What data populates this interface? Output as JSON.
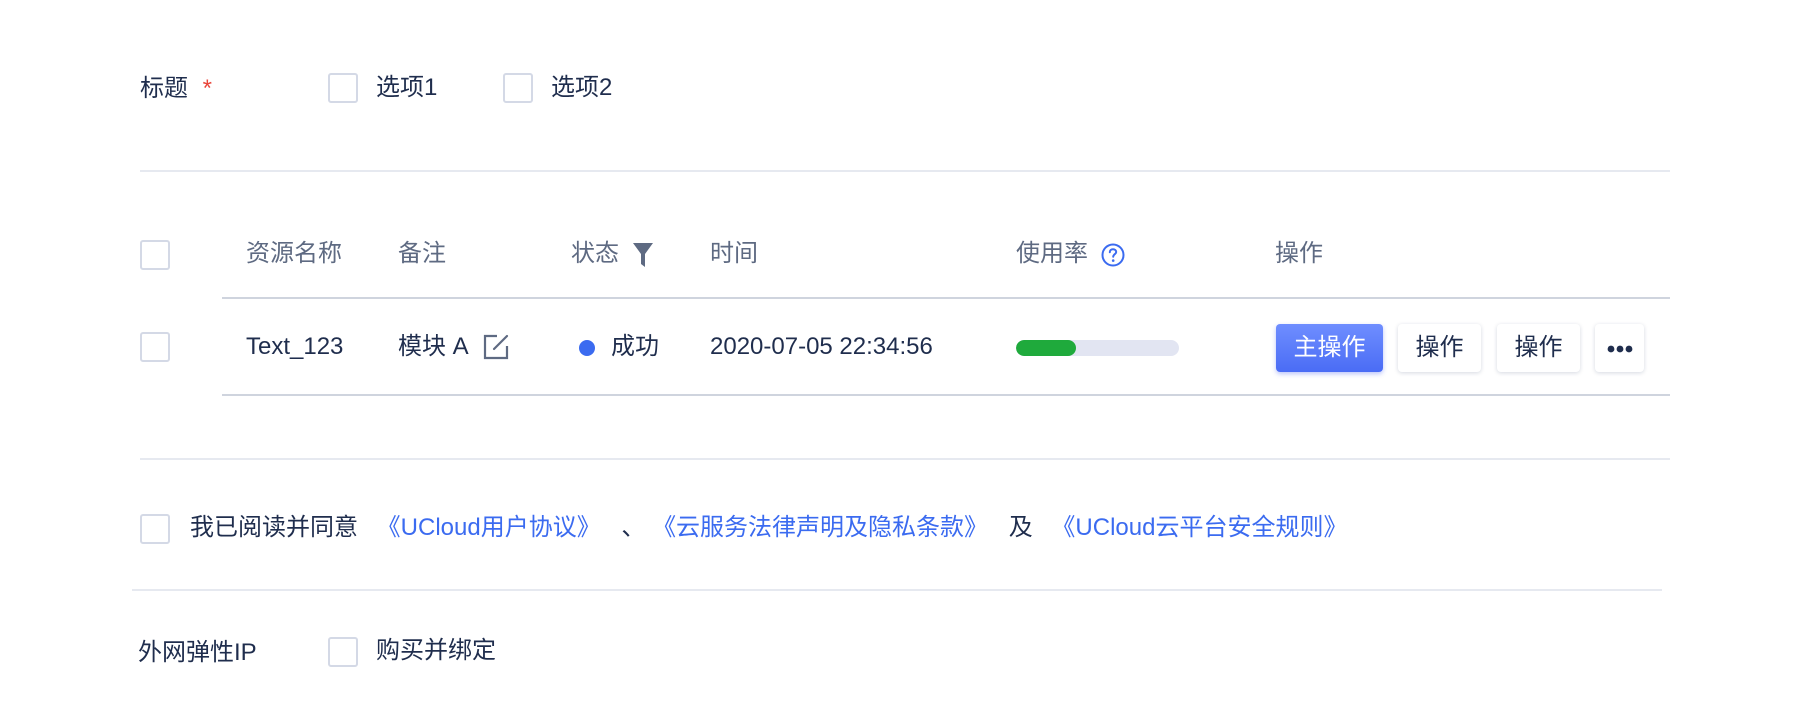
{
  "form": {
    "title_label": "标题",
    "required_mark": "*",
    "option1": "选项1",
    "option2": "选项2"
  },
  "table": {
    "columns": {
      "name": "资源名称",
      "remark": "备注",
      "status": "状态",
      "time": "时间",
      "usage": "使用率",
      "actions": "操作"
    },
    "rows": [
      {
        "name": "Text_123",
        "remark": "模块 A",
        "status": "成功",
        "status_color": "#3b6bf0",
        "time": "2020-07-05 22:34:56",
        "usage": 0.37,
        "usage_color": "#1faa3c",
        "primary_action": "主操作",
        "action2": "操作",
        "action3": "操作"
      }
    ]
  },
  "agreement": {
    "prefix": "我已阅读并同意",
    "link1": "《UCloud用户协议》",
    "sep": "、",
    "link2": "《云服务法律声明及隐私条款》",
    "conj": "及",
    "link3": "《UCloud云平台安全规则》"
  },
  "eip": {
    "label": "外网弹性IP",
    "option": "购买并绑定"
  },
  "colors": {
    "accent": "#3b6bf0",
    "required": "#e9463b",
    "success": "#1faa3c"
  }
}
